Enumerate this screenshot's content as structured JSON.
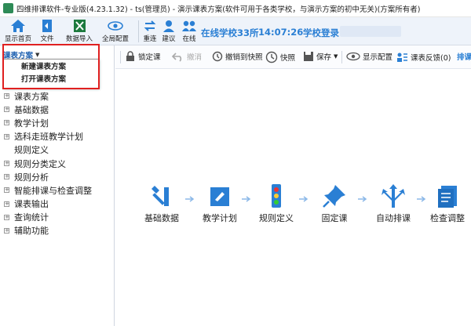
{
  "window": {
    "title": "四维排课软件-专业版(4.23.1.32) - ts(管理员) - 演示课表方案(软件可用于各类学校，与演示方案的初中无关)(方案所有者)"
  },
  "ribbon": {
    "buttons": [
      {
        "label": "显示首页",
        "icon": "home-icon"
      },
      {
        "label": "文件",
        "icon": "file-icon"
      },
      {
        "label": "数据导入",
        "icon": "excel-import-icon"
      },
      {
        "label": "全局配置",
        "icon": "eye-icon"
      },
      {
        "label": "重连",
        "icon": "reconnect-icon"
      },
      {
        "label": "建议",
        "icon": "suggest-icon"
      },
      {
        "label": "在线",
        "icon": "online-icon"
      }
    ],
    "school": "在线学校33所",
    "time": "14:07:26",
    "login": "学校登录"
  },
  "left": {
    "combo_label": "课表方案",
    "popup_items": [
      "新建课表方案",
      "打开课表方案"
    ],
    "tree": [
      {
        "label": "课表方案",
        "expander": true
      },
      {
        "label": "基础数据",
        "expander": true
      },
      {
        "label": "教学计划",
        "expander": true
      },
      {
        "label": "选科走班教学计划",
        "expander": true
      },
      {
        "label": "规则定义",
        "expander": false
      },
      {
        "label": "规则分类定义",
        "expander": true
      },
      {
        "label": "规则分析",
        "expander": true
      },
      {
        "label": "智能排课与检查调整",
        "expander": true
      },
      {
        "label": "课表输出",
        "expander": true
      },
      {
        "label": "查询统计",
        "expander": true
      },
      {
        "label": "辅助功能",
        "expander": true
      }
    ]
  },
  "toolbar": {
    "items": [
      {
        "label": "锁定课",
        "icon": "lock-icon",
        "enabled": true
      },
      {
        "label": "撤消",
        "icon": "undo-icon",
        "enabled": false
      },
      {
        "label": "撤销到快照",
        "icon": "revert-snapshot-icon",
        "enabled": true
      },
      {
        "label": "快照",
        "icon": "snapshot-icon",
        "enabled": true
      },
      {
        "label": "保存",
        "icon": "save-icon",
        "enabled": true
      },
      {
        "label": "显示配置",
        "icon": "eye-icon",
        "enabled": true
      },
      {
        "label": "课表反馈(0)",
        "icon": "feedback-icon",
        "enabled": true
      },
      {
        "label": "排课",
        "icon": "",
        "enabled": true
      }
    ]
  },
  "flow": {
    "steps": [
      {
        "label": "基础数据",
        "icon": "tools-icon"
      },
      {
        "label": "教学计划",
        "icon": "plan-icon"
      },
      {
        "label": "规则定义",
        "icon": "traffic-light-icon"
      },
      {
        "label": "固定课",
        "icon": "pin-icon"
      },
      {
        "label": "自动排课",
        "icon": "auto-schedule-icon"
      },
      {
        "label": "检查调整",
        "icon": "check-document-icon"
      }
    ]
  },
  "colors": {
    "accent": "#2a7fd4",
    "highlight_box": "#e02020",
    "flow_icon": "#2a7fd4"
  }
}
